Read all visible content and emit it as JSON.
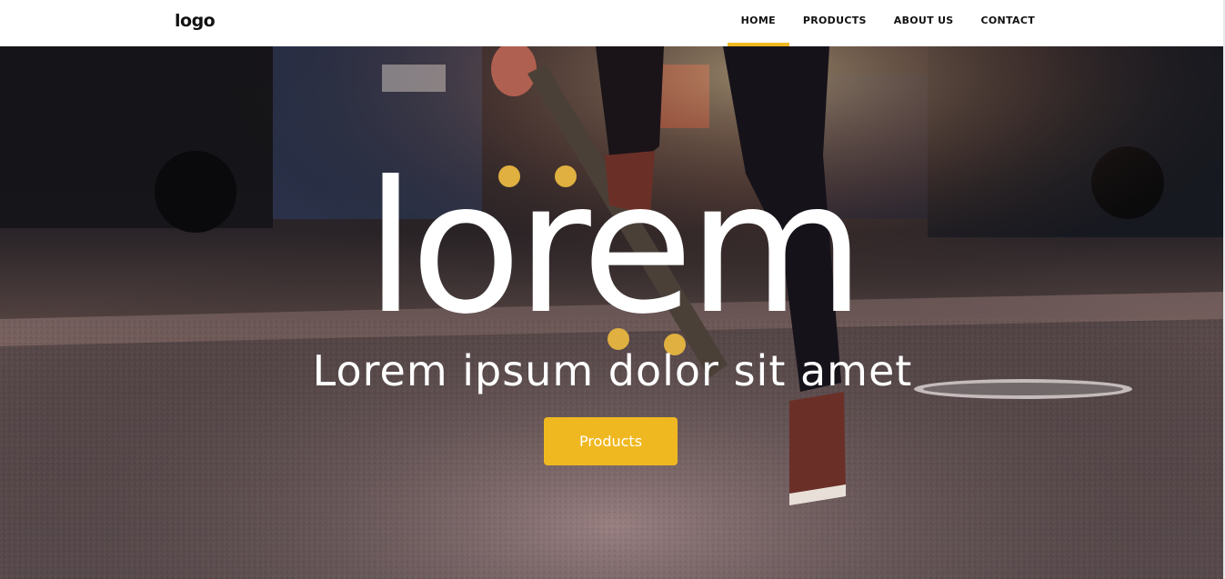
{
  "header": {
    "logo": "logo",
    "nav": [
      {
        "label": "HOME",
        "active": true
      },
      {
        "label": "PRODUCTS",
        "active": false
      },
      {
        "label": "ABOUT US",
        "active": false
      },
      {
        "label": "CONTACT",
        "active": false
      }
    ]
  },
  "hero": {
    "title": "lorem",
    "subtitle": "Lorem ipsum dolor sit amet",
    "button_label": "Products"
  },
  "colors": {
    "accent": "#f0b820",
    "header_bg": "#ffffff",
    "text_dark": "#111111"
  }
}
